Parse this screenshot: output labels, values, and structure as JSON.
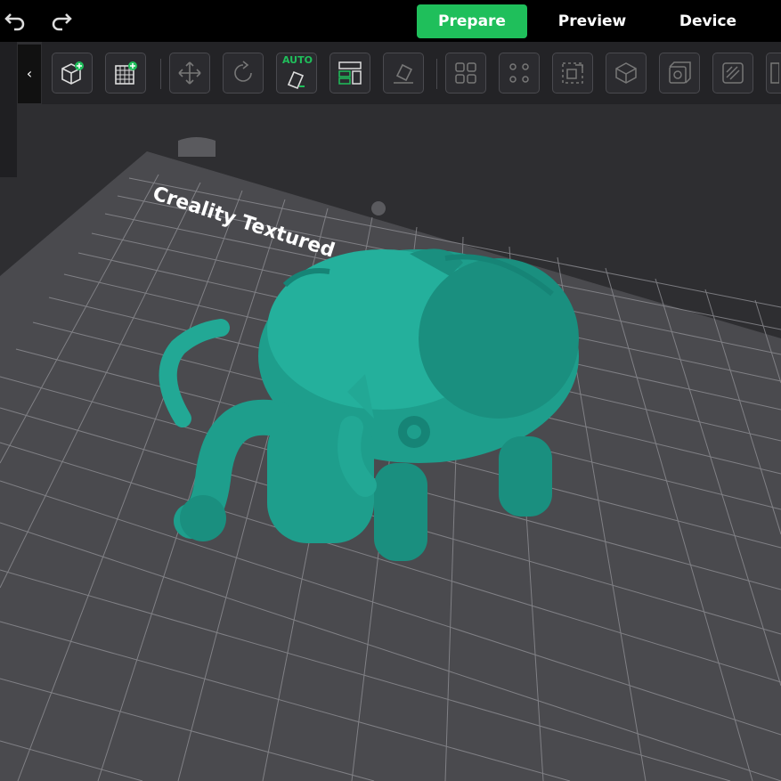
{
  "header": {
    "tabs": [
      {
        "label": "Prepare",
        "active": true
      },
      {
        "label": "Preview",
        "active": false
      },
      {
        "label": "Device",
        "active": false
      }
    ]
  },
  "toolbar": {
    "auto_label": "AUTO",
    "buttons": [
      "add-model-icon",
      "add-plate-icon",
      "move-icon",
      "rotate-icon",
      "auto-orient-icon",
      "arrange-icon",
      "lay-flat-icon",
      "split-icon",
      "assemble-icon",
      "cut-icon",
      "hollow-icon",
      "support-icon",
      "mirror-icon",
      "measure-icon"
    ]
  },
  "bed": {
    "label": "Creality Textured"
  },
  "colors": {
    "accent": "#1fbf5b",
    "model": "#1e9e8c"
  }
}
